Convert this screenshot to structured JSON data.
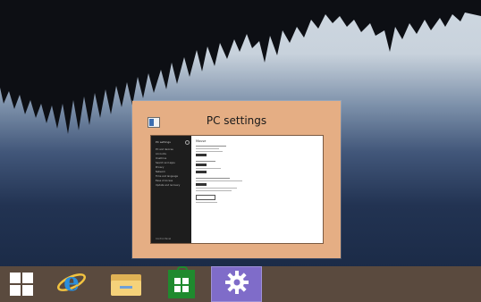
{
  "thumbnail": {
    "title": "PC settings",
    "app_icon": "pc-settings-icon",
    "background_color": "#e5ae84",
    "preview": {
      "sidebar_title": "PC settings",
      "sidebar_items": [
        "PC and devices",
        "Accounts",
        "OneDrive",
        "Search and apps",
        "Privacy",
        "Network",
        "Time and language",
        "Ease of Access",
        "Update and recovery"
      ],
      "sidebar_footer": "Control Panel",
      "content_heading": "Mouse"
    }
  },
  "taskbar": {
    "background_color": "#5a4a3e",
    "buttons": [
      {
        "name": "start",
        "icon": "windows-logo-icon",
        "active": false
      },
      {
        "name": "internet-explorer",
        "icon": "internet-explorer-icon",
        "active": false
      },
      {
        "name": "file-explorer",
        "icon": "file-explorer-icon",
        "active": false
      },
      {
        "name": "store",
        "icon": "store-icon",
        "active": false
      },
      {
        "name": "pc-settings",
        "icon": "gear-icon",
        "active": true
      }
    ],
    "active_color": "#7f6cc9"
  }
}
